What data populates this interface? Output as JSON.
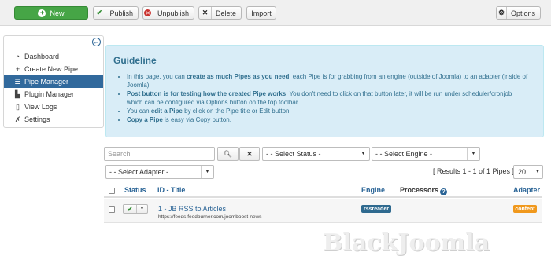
{
  "toolbar": {
    "new_label": "New",
    "publish_label": "Publish",
    "unpublish_label": "Unpublish",
    "delete_label": "Delete",
    "import_label": "Import",
    "options_label": "Options"
  },
  "sidebar": {
    "items": [
      {
        "label": "Dashboard",
        "icon": "dashboard-icon",
        "active": false
      },
      {
        "label": "Create New Pipe",
        "icon": "plus-icon",
        "active": false
      },
      {
        "label": "Pipe Manager",
        "icon": "list-icon",
        "active": true
      },
      {
        "label": "Plugin Manager",
        "icon": "plugin-icon",
        "active": false
      },
      {
        "label": "View Logs",
        "icon": "file-icon",
        "active": false
      },
      {
        "label": "Settings",
        "icon": "wrench-icon",
        "active": false
      }
    ]
  },
  "guideline": {
    "title": "Guideline",
    "items": [
      {
        "pre": "In this page, you can ",
        "bold": "create as much Pipes as you need",
        "post": ", each Pipe is for grabbing from an engine (outside of Joomla) to an adapter (inside of Joomla)."
      },
      {
        "pre": "",
        "bold": "Post button is for testing how the created Pipe works",
        "post": ". You don't need to click on that button later, it will be run under scheduler/cronjob which can be configured via Options button on the top toolbar."
      },
      {
        "pre": "You can ",
        "bold": "edit a Pipe",
        "post": " by click on the Pipe title or Edit button."
      },
      {
        "pre": "",
        "bold": "Copy a Pipe",
        "post": " is easy via Copy button."
      }
    ]
  },
  "filters": {
    "search_placeholder": "Search",
    "status_selected": "- - Select Status -",
    "engine_selected": "- - Select Engine -",
    "adapter_selected": "- - Select Adapter -",
    "results_text": "[ Results 1 - 1 of 1 Pipes ]",
    "limit_selected": "20"
  },
  "table": {
    "headers": {
      "status": "Status",
      "title": "ID - Title",
      "engine": "Engine",
      "processors": "Processors",
      "adapter": "Adapter"
    },
    "rows": [
      {
        "title": "1 - JB RSS to Articles",
        "url": "https://feeds.feedburner.com/joomboost-news",
        "engine": "rssreader",
        "adapter": "content",
        "published": true
      }
    ]
  },
  "colors": {
    "new_button": "#46a546",
    "sidebar_active": "#31699c",
    "guideline_bg": "#d9edf7",
    "guideline_text": "#31708f",
    "link": "#2a6496",
    "engine_badge": "#2f6a8f",
    "adapter_badge": "#f0981c"
  },
  "watermark": "BlackJoomla"
}
